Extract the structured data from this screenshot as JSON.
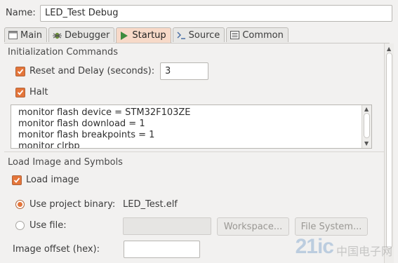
{
  "name_field": {
    "label": "Name:",
    "value": "LED_Test Debug"
  },
  "tabs": [
    {
      "label": "Main",
      "icon": "main-icon",
      "active": false
    },
    {
      "label": "Debugger",
      "icon": "bug-icon",
      "active": false
    },
    {
      "label": "Startup",
      "icon": "play-icon",
      "active": true
    },
    {
      "label": "Source",
      "icon": "source-icon",
      "active": false
    },
    {
      "label": "Common",
      "icon": "common-icon",
      "active": false
    }
  ],
  "init": {
    "title": "Initialization Commands",
    "reset_label": "Reset and Delay (seconds):",
    "reset_checked": true,
    "delay_value": "3",
    "halt_label": "Halt",
    "halt_checked": true,
    "commands": [
      "monitor flash device = STM32F103ZE",
      "monitor flash download = 1",
      "monitor flash breakpoints = 1",
      "monitor clrbp"
    ]
  },
  "load": {
    "title": "Load Image and Symbols",
    "load_image_label": "Load image",
    "load_image_checked": true,
    "use_project_binary_label": "Use project binary:",
    "project_binary_value": "LED_Test.elf",
    "use_file_label": "Use file:",
    "workspace_button": "Workspace...",
    "filesystem_button": "File System...",
    "image_offset_label": "Image offset (hex):",
    "image_offset_value": ""
  },
  "watermark": {
    "logo": "21ic",
    "text": "中国电子网"
  },
  "colors": {
    "accent": "#e4753a",
    "active_tab": "#f7d9c8"
  }
}
